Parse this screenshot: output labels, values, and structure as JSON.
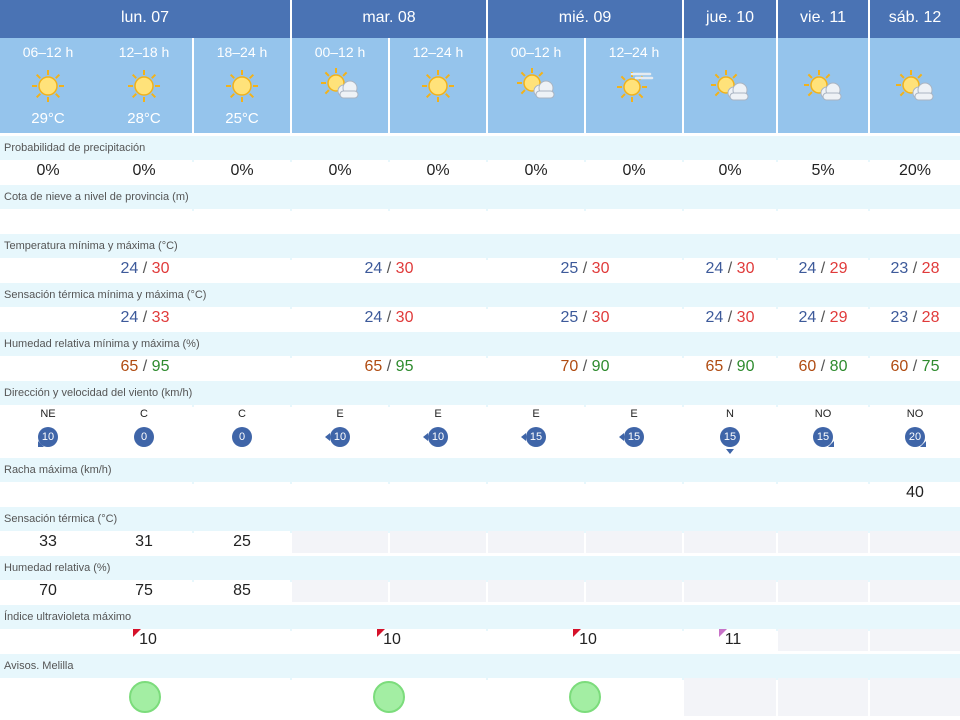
{
  "days": [
    {
      "label": "lun. 07"
    },
    {
      "label": "mar. 08"
    },
    {
      "label": "mié. 09"
    },
    {
      "label": "jue. 10"
    },
    {
      "label": "vie. 11"
    },
    {
      "label": "sáb. 12"
    }
  ],
  "periods": [
    {
      "label": "06–12 h",
      "temp": "29°C",
      "icon": "sun-icon"
    },
    {
      "label": "12–18 h",
      "temp": "28°C",
      "icon": "sun-icon"
    },
    {
      "label": "18–24 h",
      "temp": "25°C",
      "icon": "sun-icon"
    },
    {
      "label": "00–12 h",
      "temp": "",
      "icon": "sun-cloud-icon"
    },
    {
      "label": "12–24 h",
      "temp": "",
      "icon": "sun-icon"
    },
    {
      "label": "00–12 h",
      "temp": "",
      "icon": "sun-cloud-icon"
    },
    {
      "label": "12–24 h",
      "temp": "",
      "icon": "sun-haze-icon"
    },
    {
      "label": "",
      "temp": "",
      "icon": "sun-cloud-icon"
    },
    {
      "label": "",
      "temp": "",
      "icon": "sun-cloud-icon"
    },
    {
      "label": "",
      "temp": "",
      "icon": "sun-cloud-icon"
    }
  ],
  "labels": {
    "precip": "Probabilidad de precipitación",
    "snow": "Cota de nieve a nivel de provincia (m)",
    "temp": "Temperatura mínima y máxima (°C)",
    "feel": "Sensación térmica mínima y máxima (°C)",
    "hum": "Humedad relativa mínima y máxima (%)",
    "wind": "Dirección y velocidad del viento (km/h)",
    "gust": "Racha máxima (km/h)",
    "feel_h": "Sensación térmica (°C)",
    "hum_h": "Humedad relativa (%)",
    "uv": "Índice ultravioleta máximo",
    "avisos": "Avisos. Melilla"
  },
  "precip": [
    "0%",
    "0%",
    "0%",
    "0%",
    "0%",
    "0%",
    "0%",
    "0%",
    "5%",
    "20%"
  ],
  "temp": [
    {
      "min": "24",
      "max": "30"
    },
    {
      "min": "24",
      "max": "30"
    },
    {
      "min": "25",
      "max": "30"
    },
    {
      "min": "24",
      "max": "30"
    },
    {
      "min": "24",
      "max": "29"
    },
    {
      "min": "23",
      "max": "28"
    }
  ],
  "feel": [
    {
      "min": "24",
      "max": "33"
    },
    {
      "min": "24",
      "max": "30"
    },
    {
      "min": "25",
      "max": "30"
    },
    {
      "min": "24",
      "max": "30"
    },
    {
      "min": "24",
      "max": "29"
    },
    {
      "min": "23",
      "max": "28"
    }
  ],
  "hum": [
    {
      "min": "65",
      "max": "95"
    },
    {
      "min": "65",
      "max": "95"
    },
    {
      "min": "70",
      "max": "90"
    },
    {
      "min": "65",
      "max": "90"
    },
    {
      "min": "60",
      "max": "80"
    },
    {
      "min": "60",
      "max": "75"
    }
  ],
  "wind": [
    {
      "dir": "NE",
      "speed": "10"
    },
    {
      "dir": "C",
      "speed": "0"
    },
    {
      "dir": "C",
      "speed": "0"
    },
    {
      "dir": "E",
      "speed": "10"
    },
    {
      "dir": "E",
      "speed": "10"
    },
    {
      "dir": "E",
      "speed": "15"
    },
    {
      "dir": "E",
      "speed": "15"
    },
    {
      "dir": "N",
      "speed": "15"
    },
    {
      "dir": "NO",
      "speed": "15"
    },
    {
      "dir": "NO",
      "speed": "20"
    }
  ],
  "gust": [
    "",
    "",
    "",
    "",
    "",
    "",
    "",
    "",
    "",
    "40"
  ],
  "feel_h": [
    "33",
    "31",
    "25"
  ],
  "hum_h": [
    "70",
    "75",
    "85"
  ],
  "uv": [
    "10",
    "10",
    "10",
    "11"
  ],
  "colors": {
    "header": "#4a73b4",
    "period": "#95c4ec",
    "label_row": "#e7f7fc",
    "wind_circle": "#3f65a8",
    "uv_red": "#d6112a",
    "uv_purple": "#c873c8",
    "aviso_green": "#a3eea3"
  }
}
